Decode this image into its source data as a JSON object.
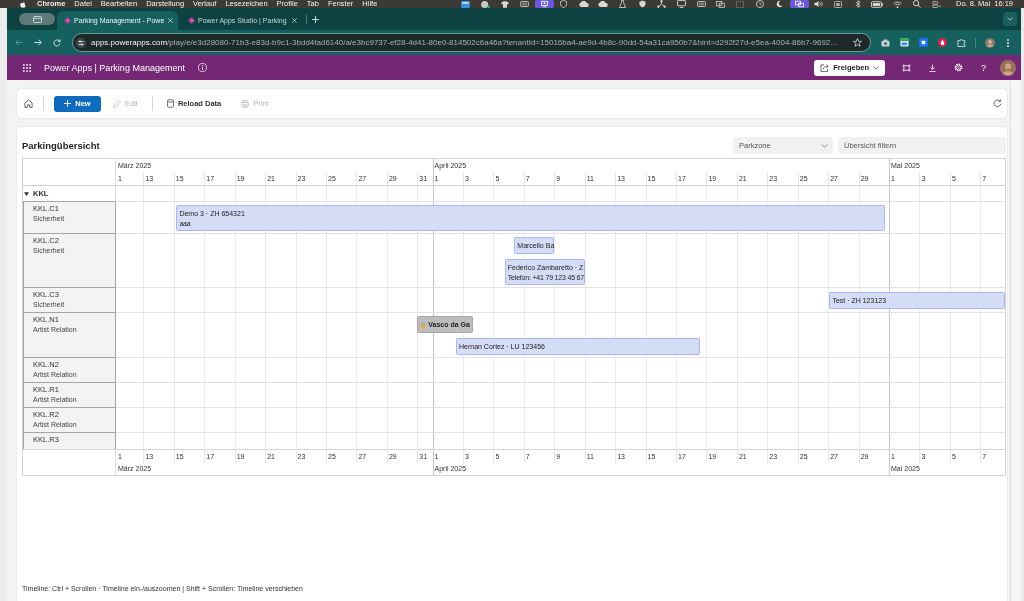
{
  "menu_bar": {
    "menus": [
      {
        "label": "Chrome",
        "kind": "app"
      },
      {
        "label": "Datei",
        "kind": "menu"
      },
      {
        "label": "Bearbeiten",
        "kind": "menu"
      },
      {
        "label": "Darstellung",
        "kind": "menu"
      },
      {
        "label": "Verlauf",
        "kind": "menu"
      },
      {
        "label": "Lesezeichen",
        "kind": "menu"
      },
      {
        "label": "Profile",
        "kind": "menu"
      },
      {
        "label": "Tab",
        "kind": "menu"
      },
      {
        "label": "Fenster",
        "kind": "menu"
      },
      {
        "label": "Hilfe",
        "kind": "menu"
      }
    ],
    "date": "Do. 8. Mai",
    "time": "16:19"
  },
  "browser": {
    "tabs": [
      {
        "title": "Parking Management - Powe",
        "selected": true
      },
      {
        "title": "Power Apps Studio | Parking",
        "selected": false
      }
    ],
    "back": {
      "disabled": true
    },
    "forward": {
      "disabled": false
    },
    "url": {
      "host": "apps.powerapps.com",
      "path": "/play/e/e3d28080-71b3-e83d-b9c1-3bdd4fad6140/a/e3bc9737-ef28-4d41-80e0-814502c6a46a?tenantId=15016ba4-ae9d-4b8c-90dd-54a31ca950b7&hint=d292f27d-e5ea-4004-86b7-9692…"
    }
  },
  "app_bar": {
    "title": "Power Apps | Parking Management",
    "share_button": "Freigeben",
    "help": "?"
  },
  "command_bar": {
    "buttons": [
      {
        "kind": "primary",
        "label": "New",
        "disabled": false
      },
      {
        "kind": "standard",
        "label": "Edit",
        "disabled": true
      },
      {
        "kind": "standard",
        "label": "Reload Data",
        "disabled": false
      },
      {
        "kind": "standard",
        "label": "Print",
        "disabled": true
      }
    ]
  },
  "overview": {
    "title": "Parkingübersicht",
    "zone_filter": {
      "placeholder": "Parkzone"
    },
    "search": {
      "placeholder": "Übersicht filtern"
    },
    "timeline": {
      "months": [
        {
          "label": "März 2025",
          "ticks": [
            "1",
            "13",
            "15",
            "17",
            "19",
            "21",
            "23",
            "25",
            "27",
            "29",
            "31"
          ]
        },
        {
          "label": "April 2025",
          "ticks": [
            "1",
            "3",
            "5",
            "7",
            "9",
            "11",
            "13",
            "15",
            "17",
            "19",
            "21",
            "23",
            "25",
            "27",
            "29"
          ]
        },
        {
          "label": "Mai 2025",
          "ticks": [
            "1",
            "3",
            "5",
            "7"
          ]
        }
      ],
      "footer_months": [
        {
          "label": "März 2025",
          "ticks": [
            "1",
            "13",
            "15",
            "17",
            "19",
            "21",
            "23",
            "25",
            "27",
            "29",
            "31"
          ]
        },
        {
          "label": "April 2025",
          "ticks": [
            "1",
            "3",
            "5",
            "7",
            "9",
            "11",
            "13",
            "15",
            "17",
            "19",
            "21",
            "23",
            "25",
            "27",
            "29"
          ]
        },
        {
          "label": "Mai 2025",
          "ticks": [
            "1",
            "3",
            "5",
            "7"
          ]
        }
      ]
    },
    "groups": [
      {
        "label": "KKL",
        "expanded": true,
        "resources": [
          {
            "name": "KKL.C1",
            "role": "Sicherheit",
            "bookings": [
              {
                "kind": "booking",
                "title": "Demo 3 · ZH 654321",
                "detail": "aaa"
              }
            ]
          },
          {
            "name": "KKL.C2",
            "role": "Sicherheit",
            "bookings": [
              {
                "kind": "booking",
                "title": "Marcello Ba"
              },
              {
                "kind": "booking",
                "title": "Federico Zambaretto · Z",
                "detail": "Telefon: +41 79 123 45 67"
              }
            ]
          },
          {
            "name": "KKL.C3",
            "role": "Sicherheit",
            "bookings": [
              {
                "kind": "booking",
                "title": "Test · ZH 123123"
              }
            ]
          },
          {
            "name": "KKL.N1",
            "role": "Artist Relation",
            "bookings": [
              {
                "kind": "locked",
                "title": "Vasco da Ga"
              },
              {
                "kind": "booking",
                "title": "Hernan Cortez · LU 123456"
              }
            ]
          },
          {
            "name": "KKL.N2",
            "role": "Artist Relation"
          },
          {
            "name": "KKL.R1",
            "role": "Artist Relation"
          },
          {
            "name": "KKL.R2",
            "role": "Artist Relation"
          },
          {
            "name": "KKL.R3"
          }
        ]
      }
    ],
    "hint": "Timeline: Ctrl + Scrollen · Timeline ein-/auszoomen | Shift + Scrollen: Timeline verschieben"
  }
}
